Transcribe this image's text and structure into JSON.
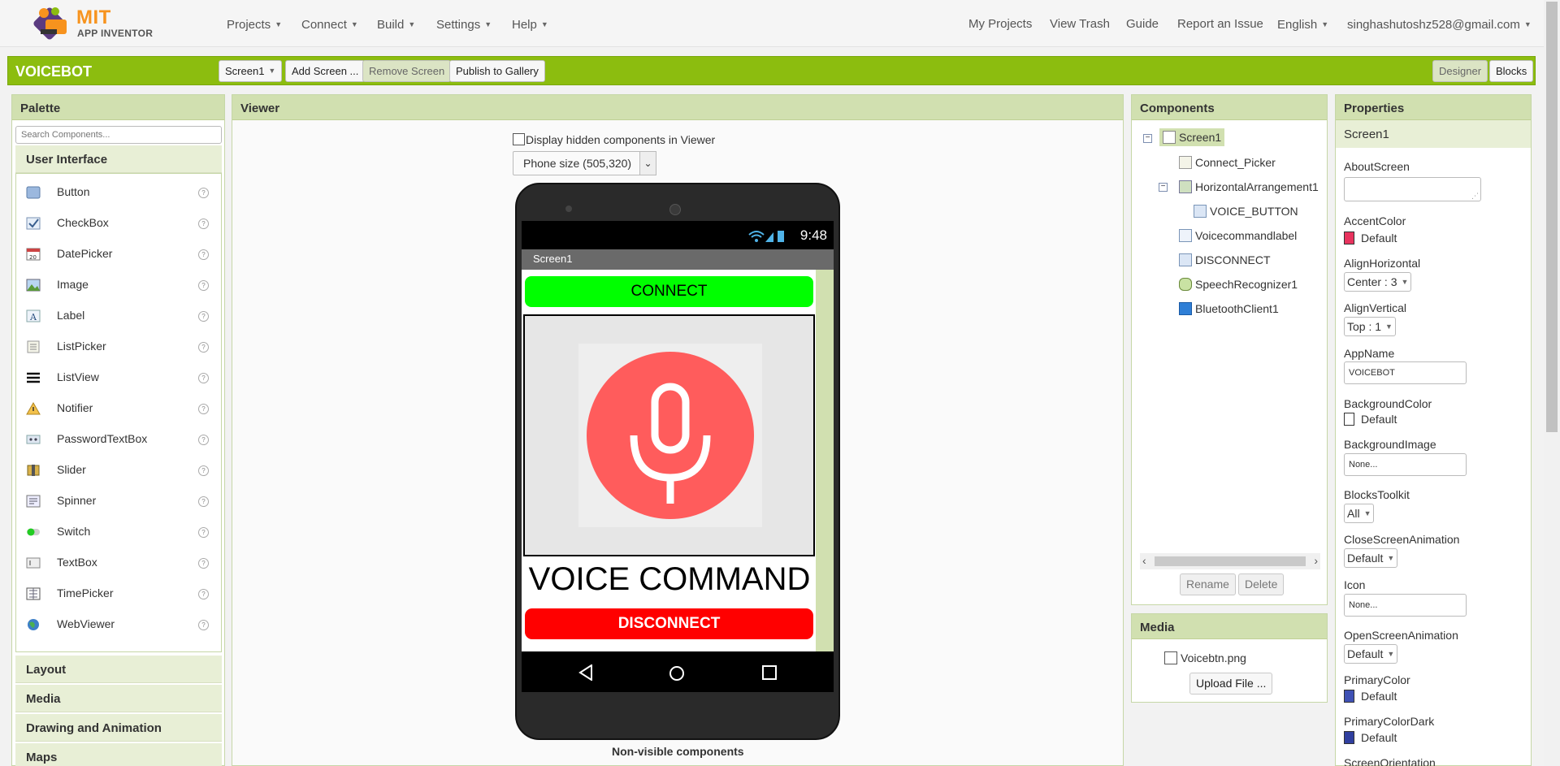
{
  "nav": {
    "logo_mit": "MIT",
    "logo_sub": "APP INVENTOR",
    "left_menu": [
      "Projects",
      "Connect",
      "Build",
      "Settings",
      "Help"
    ],
    "right_links": [
      "My Projects",
      "View Trash",
      "Guide",
      "Report an Issue"
    ],
    "language": "English",
    "account": "singhashutoshz528@gmail.com"
  },
  "project": {
    "name": "VOICEBOT",
    "screen_select": "Screen1",
    "add_screen": "Add Screen ...",
    "remove_screen": "Remove Screen",
    "publish": "Publish to Gallery",
    "designer": "Designer",
    "blocks": "Blocks"
  },
  "palette": {
    "title": "Palette",
    "search_placeholder": "Search Components...",
    "category_open": "User Interface",
    "items": [
      "Button",
      "CheckBox",
      "DatePicker",
      "Image",
      "Label",
      "ListPicker",
      "ListView",
      "Notifier",
      "PasswordTextBox",
      "Slider",
      "Spinner",
      "Switch",
      "TextBox",
      "TimePicker",
      "WebViewer"
    ],
    "help_glyph": "?",
    "categories": [
      "Layout",
      "Media",
      "Drawing and Animation",
      "Maps"
    ]
  },
  "viewer": {
    "title": "Viewer",
    "hidden_label": "Display hidden components in Viewer",
    "size_select": "Phone size (505,320)",
    "status_time": "9:48",
    "screen_title": "Screen1",
    "connect_label": "CONNECT",
    "voice_label": "VOICE COMMAND",
    "disconnect_label": "DISCONNECT",
    "nonvisible_label": "Non-visible components"
  },
  "components": {
    "title": "Components",
    "tree": [
      "Screen1",
      "Connect_Picker",
      "HorizontalArrangement1",
      "VOICE_BUTTON",
      "Voicecommandlabel",
      "DISCONNECT",
      "SpeechRecognizer1",
      "BluetoothClient1"
    ],
    "rename": "Rename",
    "delete": "Delete"
  },
  "media": {
    "title": "Media",
    "file": "Voicebtn.png",
    "upload": "Upload File ..."
  },
  "properties": {
    "title": "Properties",
    "component": "Screen1",
    "about_label": "AboutScreen",
    "accent_label": "AccentColor",
    "accent_value": "Default",
    "accent_color": "#e8335e",
    "alignh_label": "AlignHorizontal",
    "alignh_value": "Center : 3",
    "alignv_label": "AlignVertical",
    "alignv_value": "Top : 1",
    "appname_label": "AppName",
    "appname_value": "VOICEBOT",
    "bgcolor_label": "BackgroundColor",
    "bgcolor_value": "Default",
    "bgcolor_color": "#ffffff",
    "bgimage_label": "BackgroundImage",
    "bgimage_value": "None...",
    "toolkit_label": "BlocksToolkit",
    "toolkit_value": "All",
    "close_anim_label": "CloseScreenAnimation",
    "close_anim_value": "Default",
    "icon_label": "Icon",
    "icon_value": "None...",
    "open_anim_label": "OpenScreenAnimation",
    "open_anim_value": "Default",
    "primary_label": "PrimaryColor",
    "primary_value": "Default",
    "primary_color": "#3f51b5",
    "primary_dark_label": "PrimaryColorDark",
    "primary_dark_value": "Default",
    "primary_dark_color": "#303f9f",
    "orientation_label": "ScreenOrientation"
  }
}
